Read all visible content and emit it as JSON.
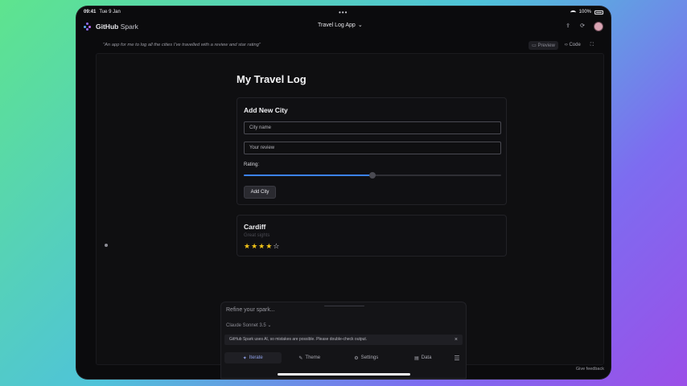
{
  "status": {
    "time": "09:41",
    "date": "Tue 9 Jan",
    "battery": "100%"
  },
  "appbar": {
    "brand": "GitHub",
    "brand_suffix": "Spark",
    "app_title": "Travel Log App"
  },
  "prompt": {
    "text": "\"An app for me to log all the cities I've travelled with a review and star rating\"",
    "tabs": {
      "preview": "Preview",
      "code": "Code"
    }
  },
  "page": {
    "title": "My Travel Log"
  },
  "form": {
    "title": "Add New City",
    "city_placeholder": "City name",
    "review_placeholder": "Your review",
    "rating_label": "Rating:",
    "rating_fraction": 0.5,
    "add_button": "Add City"
  },
  "entry": {
    "city": "Cardiff",
    "review": "Great sights",
    "stars": 4,
    "max_stars": 5
  },
  "composer": {
    "placeholder": "Refine your spark...",
    "model": "Claude Sonnet 3.5",
    "notice": "GitHub Spark uses AI, so mistakes are possible. Please double-check output.",
    "nav": {
      "iterate": "Iterate",
      "theme": "Theme",
      "settings": "Settings",
      "data": "Data"
    }
  },
  "footer": {
    "feedback": "Give feedback"
  },
  "colors": {
    "accent": "#3b82f6",
    "star": "#f5c518",
    "brand": "#8f6cf7"
  }
}
